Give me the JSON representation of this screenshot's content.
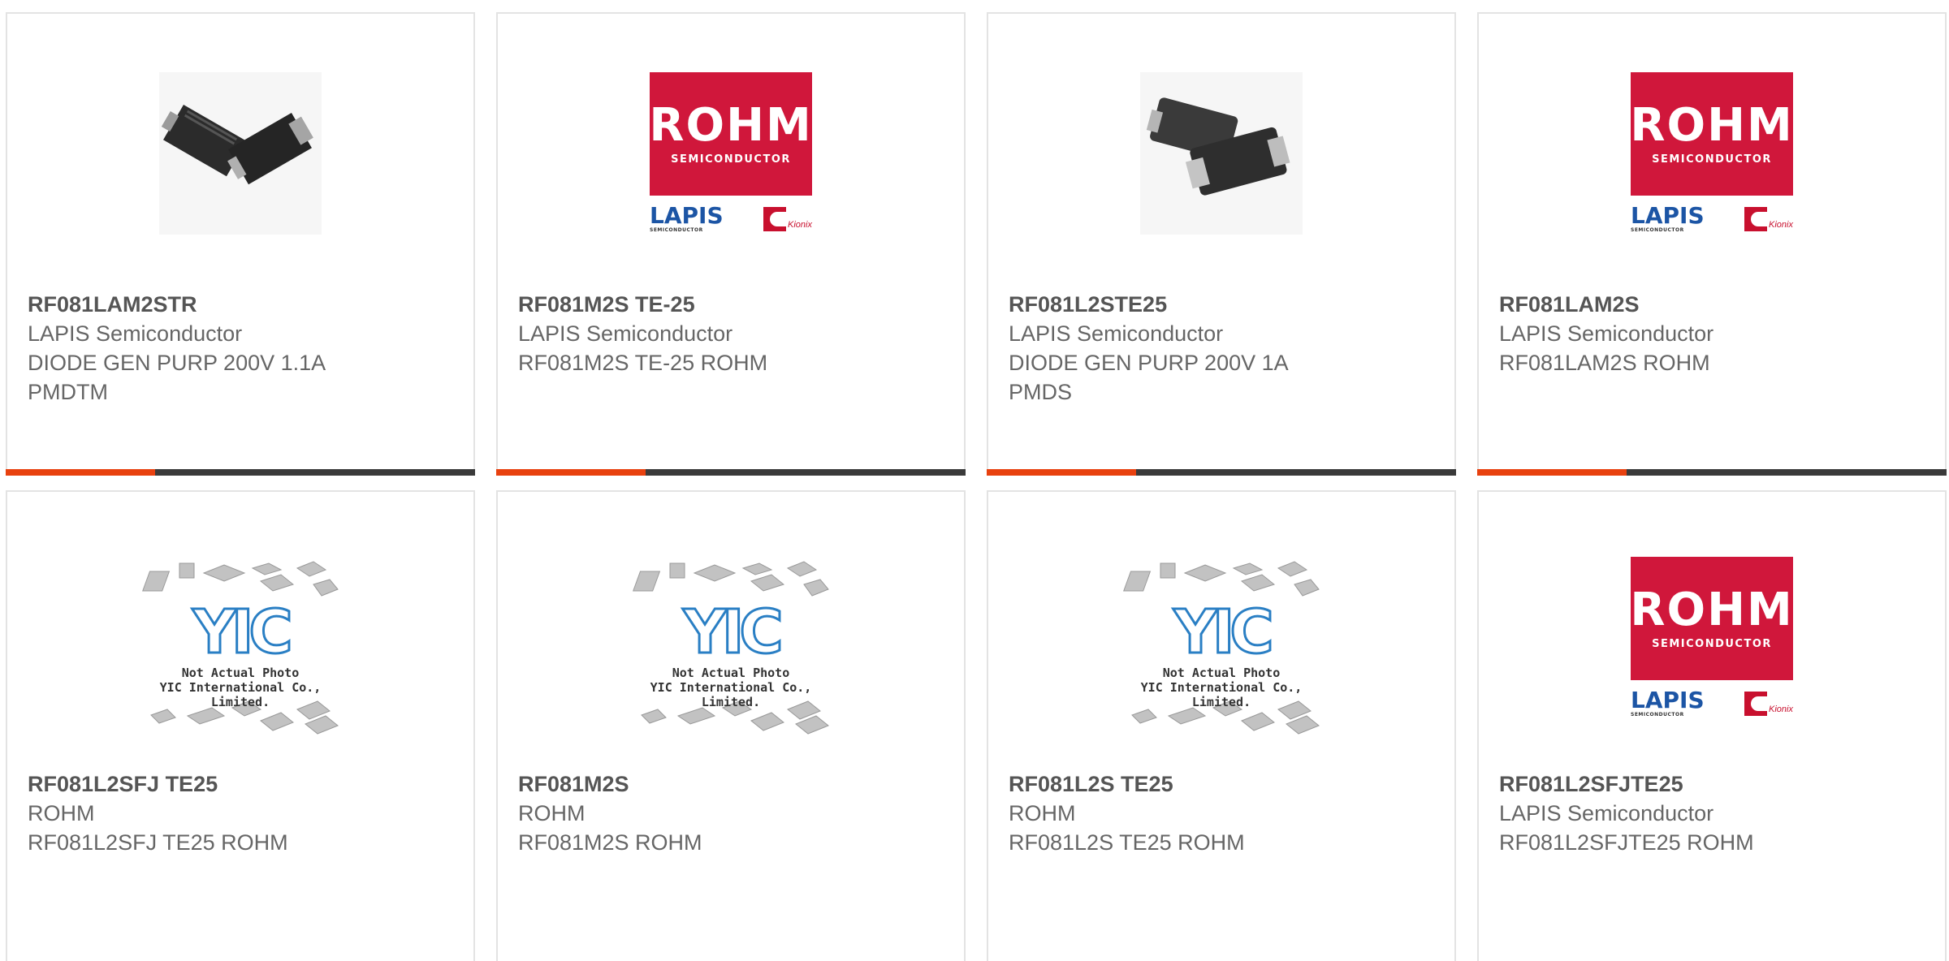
{
  "products": [
    {
      "part": "RF081LAM2STR",
      "mfr": "LAPIS Semiconductor",
      "desc": "DIODE GEN PURP 200V 1.1A\nPMDTM",
      "image": "diode-pmdtm-photo"
    },
    {
      "part": "RF081M2S TE-25",
      "mfr": "LAPIS Semiconductor",
      "desc": "RF081M2S TE-25 ROHM",
      "image": "rohm-logo"
    },
    {
      "part": "RF081L2STE25",
      "mfr": "LAPIS Semiconductor",
      "desc": "DIODE GEN PURP 200V 1A\nPMDS",
      "image": "diode-pmds-photo"
    },
    {
      "part": "RF081LAM2S",
      "mfr": "LAPIS Semiconductor",
      "desc": "RF081LAM2S ROHM",
      "image": "rohm-logo"
    },
    {
      "part": "RF081L2SFJ TE25",
      "mfr": "ROHM",
      "desc": "RF081L2SFJ TE25 ROHM",
      "image": "yic-placeholder"
    },
    {
      "part": "RF081M2S",
      "mfr": "ROHM",
      "desc": "RF081M2S ROHM",
      "image": "yic-placeholder"
    },
    {
      "part": "RF081L2S TE25",
      "mfr": "ROHM",
      "desc": "RF081L2S TE25 ROHM",
      "image": "yic-placeholder"
    },
    {
      "part": "RF081L2SFJTE25",
      "mfr": "LAPIS Semiconductor",
      "desc": "RF081L2SFJTE25 ROHM",
      "image": "rohm-logo"
    }
  ],
  "logos": {
    "rohm_word": "ROHM",
    "rohm_sub": "SEMICONDUCTOR",
    "lapis": "LAPIS",
    "lapis_sub": "SEMICONDUCTOR",
    "kionix": "Kionix"
  },
  "placeholder": {
    "brand": "YIC",
    "line1": "Not Actual Photo",
    "line2": "YIC International Co., Limited."
  },
  "colors": {
    "accent": "#e8410f",
    "bar": "#3a3a3a",
    "rohm_red": "#d0173b"
  }
}
